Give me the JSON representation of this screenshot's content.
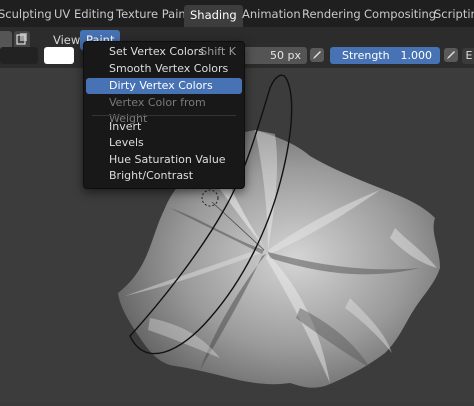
{
  "tabs": [
    "Sculpting",
    "UV Editing",
    "Texture Paint",
    "Shading",
    "Animation",
    "Rendering",
    "Compositing",
    "Scripting"
  ],
  "active_tab": "Shading",
  "header": {
    "menus": [
      "View",
      "Paint"
    ],
    "radius": "50 px",
    "strength_label": "Strength",
    "strength_value": "1.000",
    "edge_letter": "E"
  },
  "paint_menu": {
    "items": [
      {
        "label": "Set Vertex Colors",
        "shortcut": "Shift K",
        "state": "normal"
      },
      {
        "label": "Smooth Vertex Colors",
        "shortcut": "",
        "state": "normal"
      },
      {
        "label": "Dirty Vertex Colors",
        "shortcut": "",
        "state": "highlighted"
      },
      {
        "label": "Vertex Color from Weight",
        "shortcut": "",
        "state": "disabled"
      },
      {
        "label": "Invert",
        "shortcut": "",
        "state": "normal"
      },
      {
        "label": "Levels",
        "shortcut": "",
        "state": "normal"
      },
      {
        "label": "Hue Saturation Value",
        "shortcut": "",
        "state": "normal"
      },
      {
        "label": "Bright/Contrast",
        "shortcut": "",
        "state": "normal"
      }
    ]
  },
  "colors": {
    "accent": "#4772b3",
    "tab_bar": "#1f1f1f",
    "header": "#2c2c2c",
    "menu_bg": "#181818",
    "viewport": "#3c3c3c"
  }
}
